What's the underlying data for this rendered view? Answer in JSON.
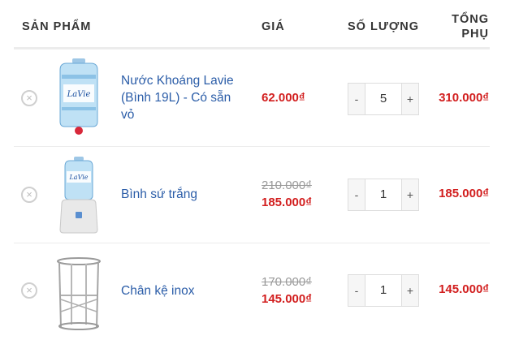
{
  "headers": {
    "product": "SẢN PHẨM",
    "price": "GIÁ",
    "quantity": "SỐ LƯỢNG",
    "subtotal_line1": "TỔNG",
    "subtotal_line2": "PHỤ"
  },
  "items": [
    {
      "name": "Nước Khoáng Lavie (Bình 19L) - Có sẵn vỏ",
      "old_price": "",
      "price": "62.000₫",
      "quantity": "5",
      "subtotal": "310.000₫",
      "image_icon": "water-jug-icon"
    },
    {
      "name": "Bình sứ trắng",
      "old_price": "210.000₫",
      "price": "185.000₫",
      "quantity": "1",
      "subtotal": "185.000₫",
      "image_icon": "ceramic-dispenser-icon"
    },
    {
      "name": "Chân kệ inox",
      "old_price": "170.000₫",
      "price": "145.000₫",
      "quantity": "1",
      "subtotal": "145.000₫",
      "image_icon": "stainless-stand-icon"
    }
  ],
  "controls": {
    "remove": "×",
    "minus": "-",
    "plus": "+"
  },
  "colors": {
    "link": "#2b5da8",
    "price": "#d21e1e",
    "border": "#ececec"
  }
}
